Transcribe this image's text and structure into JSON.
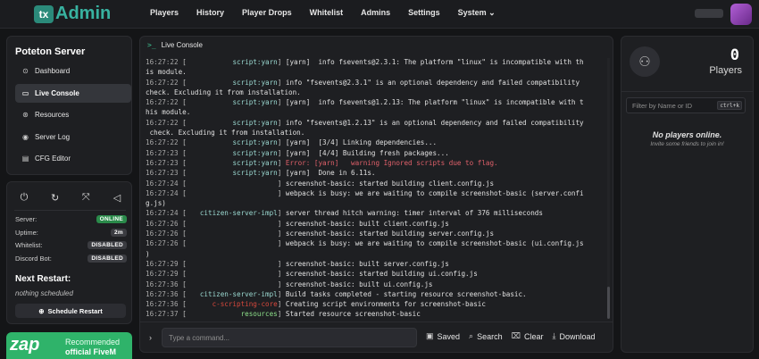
{
  "brand": {
    "logo_text": "tx",
    "name": "Admin",
    "accent": "#38b2a0"
  },
  "nav": [
    {
      "label": "Players"
    },
    {
      "label": "History"
    },
    {
      "label": "Player Drops"
    },
    {
      "label": "Whitelist"
    },
    {
      "label": "Admins"
    },
    {
      "label": "Settings"
    },
    {
      "label": "System ⌄"
    }
  ],
  "sidebar": {
    "title": "Poteton Server",
    "items": [
      {
        "label": "Dashboard",
        "icon": "dashboard-icon",
        "glyph": "⊙"
      },
      {
        "label": "Live Console",
        "icon": "terminal-icon",
        "glyph": "▭"
      },
      {
        "label": "Resources",
        "icon": "resources-icon",
        "glyph": "⊛"
      },
      {
        "label": "Server Log",
        "icon": "eye-icon",
        "glyph": "◉"
      },
      {
        "label": "CFG Editor",
        "icon": "file-icon",
        "glyph": "▤"
      }
    ]
  },
  "status": {
    "controls": [
      {
        "icon": "power-off-icon",
        "glyph": "⏻"
      },
      {
        "icon": "restart-icon",
        "glyph": "↻"
      },
      {
        "icon": "scan-icon",
        "glyph": "⤧"
      },
      {
        "icon": "megaphone-icon",
        "glyph": "◁"
      }
    ],
    "rows": [
      {
        "label": "Server:",
        "value": "ONLINE",
        "kind": "online"
      },
      {
        "label": "Uptime:",
        "value": "2m",
        "kind": "plain"
      },
      {
        "label": "Whitelist:",
        "value": "DISABLED",
        "kind": "dark"
      },
      {
        "label": "Discord Bot:",
        "value": "DISABLED",
        "kind": "dark"
      }
    ],
    "next_restart_title": "Next Restart:",
    "next_restart_value": "nothing scheduled",
    "schedule_button": "Schedule Restart",
    "online_color": "#2a8a4a"
  },
  "ad": {
    "logo": "zap",
    "line1": "Recommended",
    "line2": "official FiveM"
  },
  "console": {
    "title": "Live Console",
    "lines": [
      {
        "ts": "16:27:22",
        "src": "script:yarn",
        "color": "",
        "msg": "[yarn]  info fsevents@2.3.1: The platform \"linux\" is incompatible with th"
      },
      {
        "ts": "",
        "src": "",
        "color": "",
        "msg": "is module.",
        "cont": true
      },
      {
        "ts": "16:27:22",
        "src": "script:yarn",
        "color": "",
        "msg": "info \"fsevents@2.3.1\" is an optional dependency and failed compatibility"
      },
      {
        "ts": "",
        "src": "",
        "color": "",
        "msg": "check. Excluding it from installation.",
        "cont": true
      },
      {
        "ts": "16:27:22",
        "src": "script:yarn",
        "color": "",
        "msg": "[yarn]  info fsevents@1.2.13: The platform \"linux\" is incompatible with t"
      },
      {
        "ts": "",
        "src": "",
        "color": "",
        "msg": "his module.",
        "cont": true
      },
      {
        "ts": "16:27:22",
        "src": "script:yarn",
        "color": "",
        "msg": "info \"fsevents@1.2.13\" is an optional dependency and failed compatibility"
      },
      {
        "ts": "",
        "src": "",
        "color": "",
        "msg": " check. Excluding it from installation.",
        "cont": true
      },
      {
        "ts": "16:27:22",
        "src": "script:yarn",
        "color": "",
        "msg": "[yarn]  [3/4] Linking dependencies..."
      },
      {
        "ts": "16:27:23",
        "src": "script:yarn",
        "color": "",
        "msg": "[yarn]  [4/4] Building fresh packages..."
      },
      {
        "ts": "16:27:23",
        "src": "script:yarn",
        "color": "",
        "msg": "Error: [yarn]   warning Ignored scripts due to flag.",
        "err": true
      },
      {
        "ts": "16:27:23",
        "src": "script:yarn",
        "color": "",
        "msg": "[yarn]  Done in 6.11s."
      },
      {
        "ts": "16:27:24",
        "src": "",
        "color": "blue",
        "msg": "screenshot-basic: started building client.config.js"
      },
      {
        "ts": "16:27:24",
        "src": "",
        "color": "blue",
        "msg": "webpack is busy: we are waiting to compile screenshot-basic (server.confi"
      },
      {
        "ts": "",
        "src": "",
        "color": "",
        "msg": "g.js)",
        "cont": true
      },
      {
        "ts": "16:27:24",
        "src": "citizen-server-impl",
        "color": "",
        "msg": "server thread hitch warning: timer interval of 376 milliseconds"
      },
      {
        "ts": "16:27:26",
        "src": "",
        "color": "blue",
        "msg": "screenshot-basic: built client.config.js"
      },
      {
        "ts": "16:27:26",
        "src": "",
        "color": "blue",
        "msg": "screenshot-basic: started building server.config.js"
      },
      {
        "ts": "16:27:26",
        "src": "",
        "color": "blue",
        "msg": "webpack is busy: we are waiting to compile screenshot-basic (ui.config.js"
      },
      {
        "ts": "",
        "src": "",
        "color": "",
        "msg": ")",
        "cont": true
      },
      {
        "ts": "16:27:29",
        "src": "",
        "color": "blue",
        "msg": "screenshot-basic: built server.config.js"
      },
      {
        "ts": "16:27:29",
        "src": "",
        "color": "blue",
        "msg": "screenshot-basic: started building ui.config.js"
      },
      {
        "ts": "16:27:36",
        "src": "",
        "color": "blue",
        "msg": "screenshot-basic: built ui.config.js"
      },
      {
        "ts": "16:27:36",
        "src": "citizen-server-impl",
        "color": "",
        "msg": "Build tasks completed - starting resource screenshot-basic."
      },
      {
        "ts": "16:27:36",
        "src": "c-scripting-core",
        "color": "red",
        "msg": "Creating script environments for screenshot-basic"
      },
      {
        "ts": "16:27:37",
        "src": "resources",
        "color": "green",
        "msg": "Started resource screenshot-basic"
      }
    ],
    "input_placeholder": "Type a command...",
    "actions": [
      {
        "label": "Saved",
        "icon": "save-icon",
        "glyph": "▣"
      },
      {
        "label": "Search",
        "icon": "search-icon",
        "glyph": "⌕"
      },
      {
        "label": "Clear",
        "icon": "trash-icon",
        "glyph": "⌧"
      },
      {
        "label": "Download",
        "icon": "download-icon",
        "glyph": "⤓"
      }
    ]
  },
  "players": {
    "count": "0",
    "label": "Players",
    "search_placeholder": "Filter by Name or ID",
    "shortcut": "ctrl+k",
    "empty_title": "No players online.",
    "empty_hint": "Invite some friends to join in!"
  }
}
